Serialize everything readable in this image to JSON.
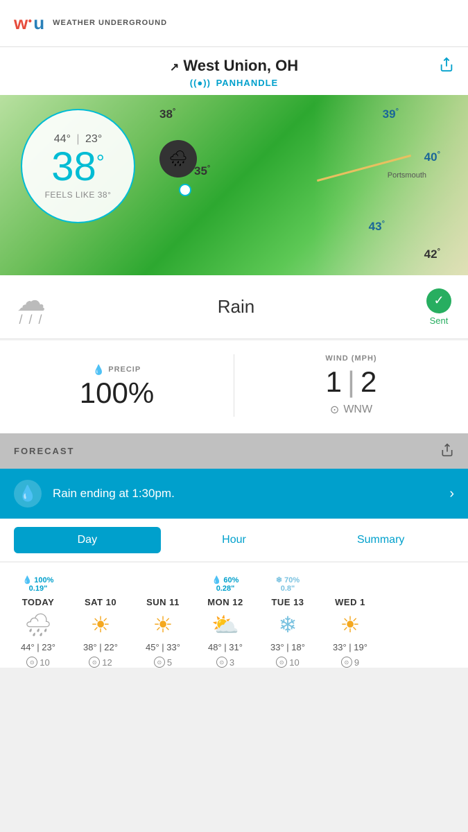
{
  "app": {
    "name": "WEATHER UNDERGROUND"
  },
  "location": {
    "city": "West Union, OH",
    "station": "PANHANDLE",
    "arrow": "↗"
  },
  "current": {
    "hi": "44°",
    "lo": "23°",
    "temp": "38",
    "feels_like": "FEELS LIKE 38°",
    "condition": "Rain",
    "sent_label": "Sent"
  },
  "map_temps": [
    {
      "value": "38°",
      "id": "t1"
    },
    {
      "value": "39°",
      "id": "t2"
    },
    {
      "value": "40°",
      "id": "t3"
    },
    {
      "value": "43°",
      "id": "t4"
    },
    {
      "value": "42°",
      "id": "t5"
    },
    {
      "value": "35°",
      "id": "t6"
    }
  ],
  "stats": {
    "precip_label": "PRECIP",
    "precip_value": "100%",
    "wind_label": "WIND (MPH)",
    "wind_lo": "1",
    "wind_hi": "2",
    "wind_dir": "WNW"
  },
  "forecast": {
    "section_label": "FORECAST",
    "banner_text": "Rain ending at 1:30pm.",
    "tabs": [
      {
        "label": "Day",
        "active": true
      },
      {
        "label": "Hour",
        "active": false
      },
      {
        "label": "Summary",
        "active": false
      }
    ],
    "days": [
      {
        "name": "TODAY",
        "precip": "100%",
        "precip2": "0.19\"",
        "hi": "44°",
        "lo": "23°",
        "wind": "10",
        "icon": "rain",
        "snow": false
      },
      {
        "name": "SAT 10",
        "precip": "",
        "precip2": "",
        "hi": "38°",
        "lo": "22°",
        "wind": "12",
        "icon": "sun",
        "snow": false
      },
      {
        "name": "SUN 11",
        "precip": "",
        "precip2": "",
        "hi": "45°",
        "lo": "33°",
        "wind": "5",
        "icon": "sun",
        "snow": false
      },
      {
        "name": "MON 12",
        "precip": "60%",
        "precip2": "0.28\"",
        "hi": "48°",
        "lo": "31°",
        "wind": "3",
        "icon": "partly",
        "snow": false
      },
      {
        "name": "TUE 13",
        "precip": "70%",
        "precip2": "0.8\"",
        "hi": "33°",
        "lo": "18°",
        "wind": "10",
        "icon": "snow",
        "snow": true
      },
      {
        "name": "WED 1",
        "precip": "",
        "precip2": "",
        "hi": "33°",
        "lo": "19°",
        "wind": "9",
        "icon": "sun",
        "snow": false
      }
    ]
  }
}
